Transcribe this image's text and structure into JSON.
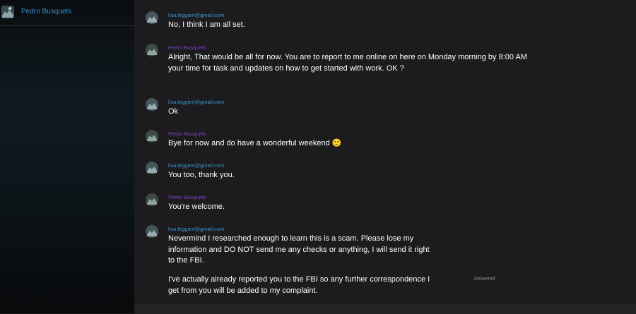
{
  "sidebar": {
    "contact_name": "Pedro Busquets"
  },
  "messages": [
    {
      "sender": "lisa.leggieri@gmail.com",
      "role": "lisa",
      "lines": [
        "No, I think I am all set."
      ]
    },
    {
      "sender": "Pedro Busquets",
      "role": "pedro",
      "lines": [
        "Alright, That would be all for now. You are to report  to me online on here  on Monday morning by 8:00 AM your time for task and updates on how to get started with work. OK ?"
      ]
    },
    {
      "sender": "lisa.leggieri@gmail.com",
      "role": "lisa",
      "lines": [
        "Ok"
      ]
    },
    {
      "sender": "Pedro Busquets",
      "role": "pedro",
      "lines": [
        "Bye for now and do have a wonderful weekend 🙂"
      ]
    },
    {
      "sender": "lisa.leggieri@gmail.com",
      "role": "lisa",
      "lines": [
        "You too, thank you."
      ]
    },
    {
      "sender": "Pedro Busquets",
      "role": "pedro",
      "lines": [
        "You're welcome."
      ]
    },
    {
      "sender": "lisa.leggieri@gmail.com",
      "role": "lisa",
      "lines": [
        "Nevermind I researched enough to learn this is a scam.  Please lose my information and DO NOT send me any checks or anything, I will send it right to the FBI.",
        "I've actually already reported you to the FBI so any further correspondence I get from you will be added to my complaint."
      ]
    }
  ],
  "status": {
    "delivered_label": "Delivered"
  },
  "colors": {
    "lisa": "#3c93cc",
    "pedro": "#7d3fc2",
    "sidebar_link": "#3f8fcf"
  }
}
